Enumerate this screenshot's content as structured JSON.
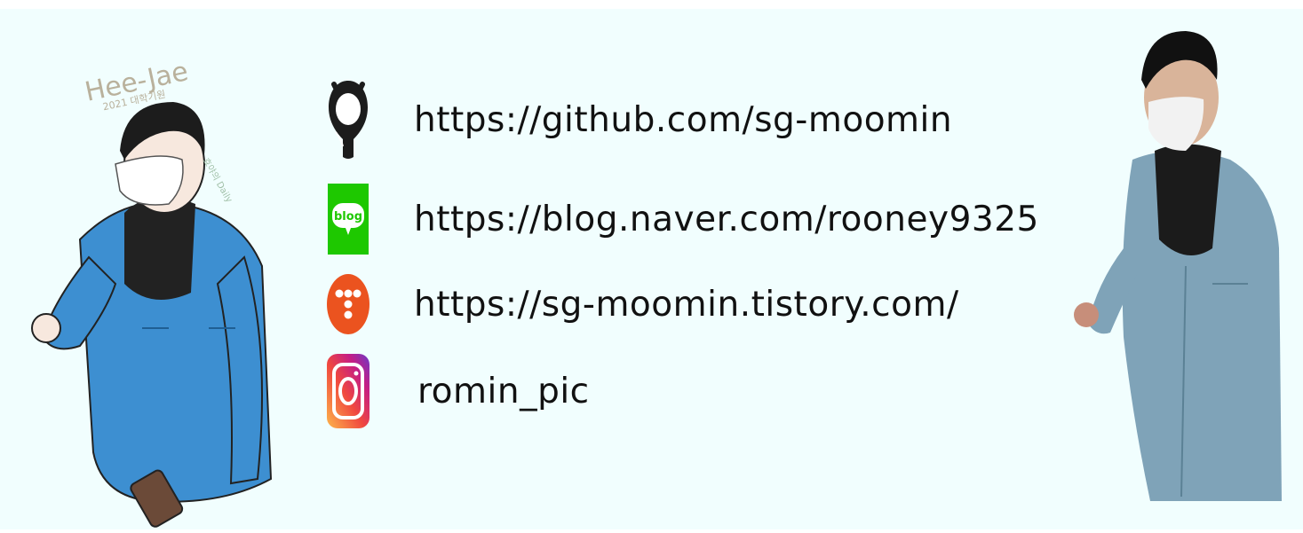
{
  "links": [
    {
      "icon": "github-icon",
      "text": "https://github.com/sg-moomin"
    },
    {
      "icon": "naver-blog-icon",
      "text": "https://blog.naver.com/rooney9325",
      "icon_text": "blog"
    },
    {
      "icon": "tistory-icon",
      "text": "https://sg-moomin.tistory.com/"
    },
    {
      "icon": "instagram-icon",
      "text": "romin_pic"
    }
  ],
  "illustration": {
    "name_text": "Hee-Jae",
    "sub_text": "2021 대학기원",
    "side_text": "효야의 Daily"
  },
  "colors": {
    "background": "#f1fefe",
    "naver_green": "#1ec800",
    "tistory_orange": "#eb531f",
    "jacket_blue": "#3d8fd1",
    "photo_jacket": "#7fa3b8"
  }
}
